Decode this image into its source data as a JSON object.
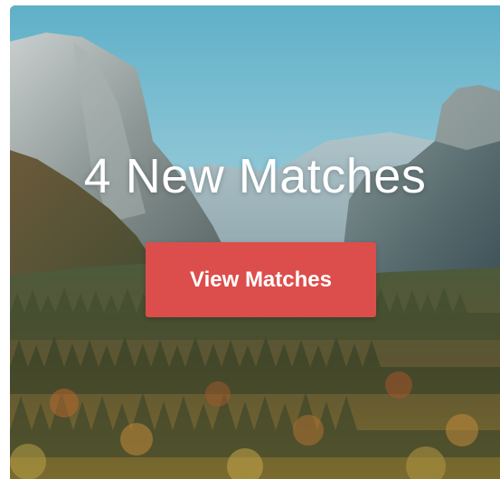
{
  "promo": {
    "headline": "4 New Matches",
    "button_label": "View Matches"
  },
  "colors": {
    "button_bg": "#dc4e4b",
    "headline_text": "#ffffff",
    "button_text": "#ffffff"
  },
  "background": {
    "subject": "mountain valley landscape"
  }
}
